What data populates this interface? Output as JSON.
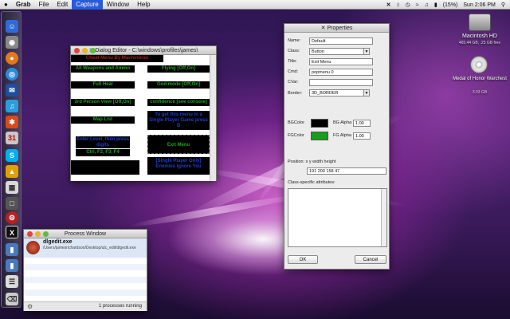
{
  "menubar": {
    "apple": "",
    "items": [
      "Grab",
      "File",
      "Edit",
      "Capture",
      "Window",
      "Help"
    ],
    "active": "Capture",
    "battery": "(15%)",
    "clock": "Sun 2:06 PM"
  },
  "desktop_icons": [
    {
      "name": "Macintosh HD",
      "sub": "465.44 GB, .25 GB free"
    },
    {
      "name": "Medal of Honor Warchest",
      "sub": "3.03 GB"
    }
  ],
  "dialog_editor": {
    "title": "Dialog Editor - C:\\windows\\profiles\\james\\",
    "buttons": [
      "Cheat Menu By Machinbrax",
      "All Weapons and Ammo",
      "Flying [Off,On]",
      "Full Heal",
      "God mode [Off,On]",
      "3rd Person View [Off,On]",
      "confidence [see console]",
      "Map List",
      "To get this menu in a Single Player Game press B",
      "Enter Level, then press digits",
      "Ctrl, F2, F3, F4",
      "Exit Menu",
      "[Single Player Only] Enemies Ignore You",
      ""
    ]
  },
  "properties": {
    "title": "Properties",
    "name_label": "Name:",
    "name_value": "Default",
    "class_label": "Class:",
    "class_value": "Button",
    "title_label": "Title:",
    "title_value": "Exit Menu",
    "cmd_label": "Cmd:",
    "cmd_value": "popmenu 0",
    "cvar_label": "CVar:",
    "cvar_value": "",
    "border_label": "Border:",
    "border_value": "3D_BORDER",
    "bgcolor_label": "BGColor",
    "bgalpha_label": "BG Alpha",
    "bgalpha_value": "1.00",
    "fgcolor_label": "FGColor",
    "fgalpha_label": "FG Alpha",
    "fgalpha_value": "1.00",
    "bg_color": "#000000",
    "fg_color": "#1a9e1a",
    "position_label": "Position: x y width height",
    "position_value": "191 200 158 47",
    "class_specific_label": "Class-specific attributes:",
    "ok_label": "OK",
    "cancel_label": "Cancel"
  },
  "process_window": {
    "title": "Process Window",
    "item_name": "dlgedit.exe",
    "item_path": "/Users/jamesrichardson/Desktop/utc_edit/dlgedit.exe",
    "status": "1 processes running"
  }
}
